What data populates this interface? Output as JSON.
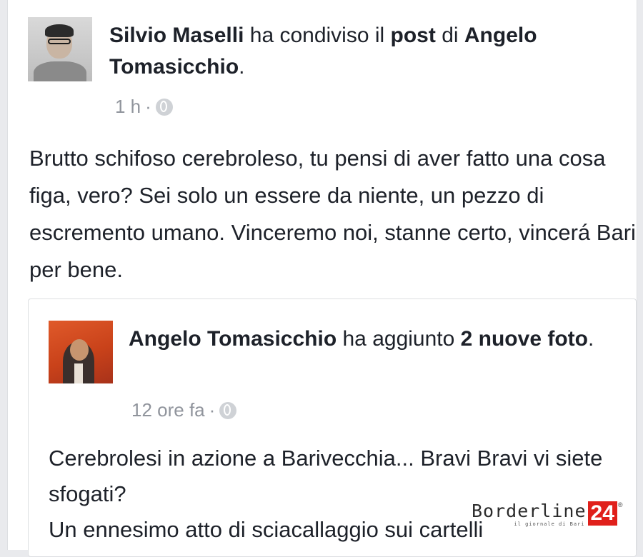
{
  "post": {
    "author": "Silvio Maselli",
    "shared_text": " ha condiviso il ",
    "post_word": "post",
    "of_word": " di ",
    "source_author": "Angelo Tomasicchio",
    "end_dot": ".",
    "time": "1 h",
    "separator": " · ",
    "privacy_icon": "globe-icon",
    "text": "Brutto schifoso cerebroleso, tu pensi di aver fatto una cosa figa, vero? Sei solo un essere da niente, un pezzo di escremento umano. Vinceremo noi, stanne certo, vincerá Bari per bene."
  },
  "shared_post": {
    "author": "Angelo Tomasicchio",
    "action_text": " ha aggiunto ",
    "photos": "2 nuove foto",
    "end_dot": ".",
    "time": "12 ore fa",
    "separator": " · ",
    "privacy_icon": "globe-icon",
    "text_line1": "Cerebrolesi in azione a Barivecchia... Bravi Bravi vi siete sfogati?",
    "text_line2": "Un ennesimo atto di sciacallaggio sui cartelli"
  },
  "watermark": {
    "word": "Borderline",
    "number": "24",
    "registered": "®",
    "tagline": "il giornale di Bari"
  },
  "colors": {
    "text": "#1d2129",
    "meta": "#90949c",
    "brand_red": "#e0201b"
  }
}
